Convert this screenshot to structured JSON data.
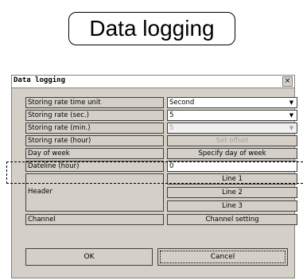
{
  "banner": {
    "title": "Data logging"
  },
  "dialog": {
    "title": "Data logging",
    "close_label": "×",
    "rows": {
      "storing_rate_time_unit": {
        "label": "Storing rate time unit",
        "value": "Second"
      },
      "storing_rate_sec": {
        "label": "Storing rate (sec.)",
        "value": "5"
      },
      "storing_rate_min": {
        "label": "Storing rate (min.)",
        "value": "5"
      },
      "storing_rate_hour": {
        "label": "Storing rate (hour)",
        "button": "Set offset"
      },
      "day_of_week": {
        "label": "Day of week",
        "button": "Specify day of week"
      },
      "dateline_hour": {
        "label": "Dateline (hour)",
        "value": "0"
      },
      "header": {
        "label": "Header",
        "lines": [
          "Line 1",
          "Line 2",
          "Line 3"
        ]
      },
      "channel": {
        "label": "Channel",
        "button": "Channel setting"
      }
    },
    "ok_label": "OK",
    "cancel_label": "Cancel",
    "dropdown_glyph": "▼"
  }
}
